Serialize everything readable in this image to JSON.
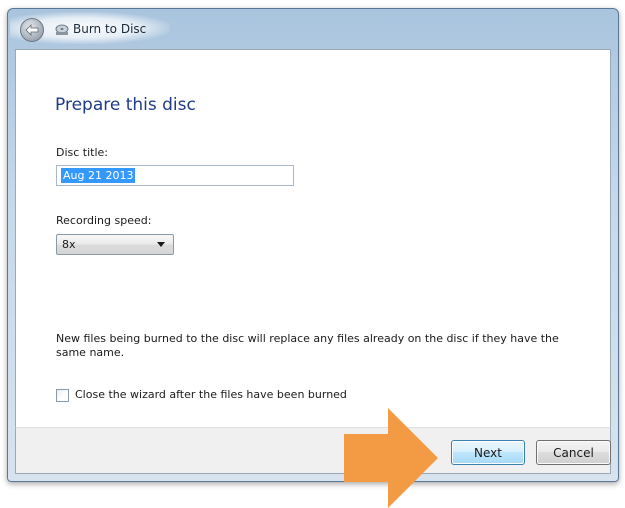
{
  "window": {
    "title": "Burn to Disc",
    "back_icon": "back-arrow-icon",
    "app_icon": "burn-disc-icon"
  },
  "main": {
    "heading": "Prepare this disc",
    "disc_title_label": "Disc title:",
    "disc_title_value": "Aug 21 2013",
    "recording_speed_label": "Recording speed:",
    "recording_speed_value": "8x",
    "info_text": "New files being burned to the disc will replace any files already on the disc if they have the same name.",
    "close_wizard_label": "Close the wizard after the files have been burned",
    "close_wizard_checked": false
  },
  "footer": {
    "next_label": "Next",
    "cancel_label": "Cancel"
  },
  "colors": {
    "heading": "#1e3a8a",
    "selection": "#3399ff",
    "annotation_arrow": "#f39a45"
  }
}
